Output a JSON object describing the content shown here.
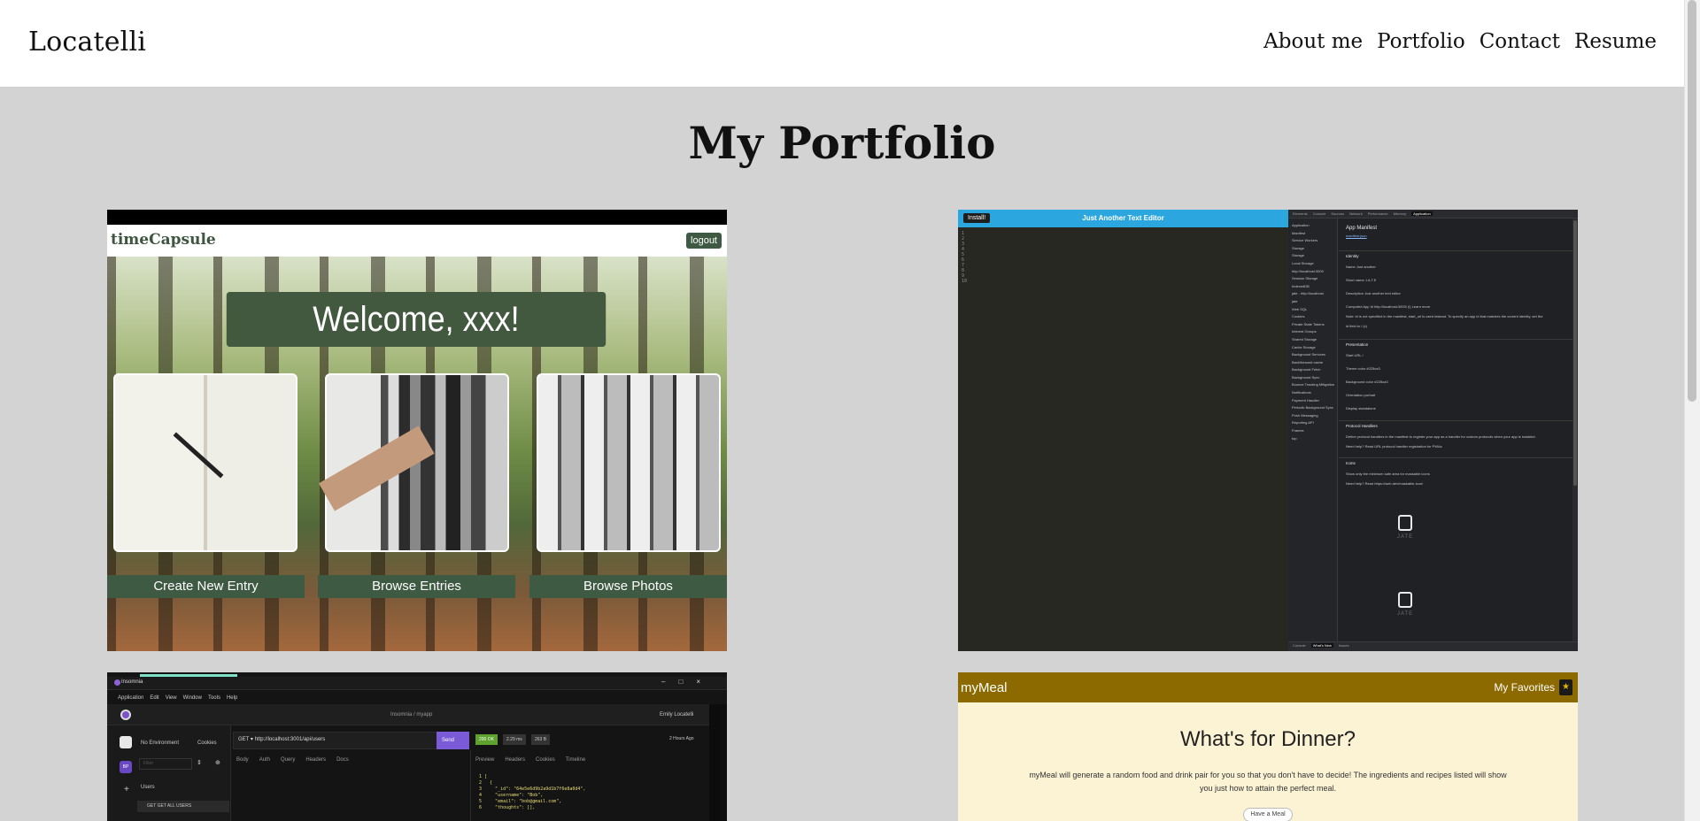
{
  "header": {
    "brand": "Locatelli",
    "nav": [
      "About me",
      "Portfolio",
      "Contact",
      "Resume"
    ]
  },
  "page_title": "My Portfolio",
  "projects": [
    {
      "app_name": "timeCapsule",
      "logout": "logout",
      "welcome": "Welcome, xxx!",
      "buttons": [
        "Create New Entry",
        "Browse Entries",
        "Browse Photos"
      ]
    },
    {
      "install": "Install!",
      "title": "Just Another Text Editor",
      "devtools_tabs": [
        "Elements",
        "Console",
        "Sources",
        "Network",
        "Performance",
        "Memory",
        "Application"
      ],
      "tree": [
        "Application",
        "Manifest",
        "Service Workers",
        "Storage",
        "",
        "Storage",
        "Local Storage",
        "http://localhost:3000",
        "Session Storage",
        "IndexedDB",
        "jate - http://localhost",
        "jate",
        "Web SQL",
        "Cookies",
        "Private State Tokens",
        "Interest Groups",
        "Shared Storage",
        "Cache Storage",
        "",
        "Background Services",
        "Back/forward cache",
        "Background Fetch",
        "Background Sync",
        "Bounce Tracking Mitigation",
        "Notifications",
        "Payment Handler",
        "Periodic Background Sync",
        "Push Messaging",
        "Reporting API",
        "",
        "Frames",
        "top"
      ],
      "manifest_title": "App Manifest",
      "manifest_link": "manifest.json",
      "sections": [
        "Identity",
        "Presentation",
        "Protocol Handlers",
        "Icons"
      ],
      "identity": [
        "Name  Just another",
        "Short name  J.A.T.E",
        "Description  Just another text editor",
        "Computed App Id  http://localhost:3000/ (i) Learn more",
        "Note: id is not specified in the manifest, start_url is used instead. To specify an app id that matches the current identity, set the",
        "id field to / (c)"
      ],
      "presentation": [
        "Start URL  /",
        "Theme color  #225ca3",
        "Background color  #225ca3",
        "Orientation  portrait",
        "Display  standalone"
      ],
      "protocol": [
        "Define protocol handlers in the manifest to register your app as a handler for custom protocols when your app is installed.",
        "Need help? Read URL protocol handler registration for PWAs"
      ],
      "icons_notes": [
        "Show only the minimum safe area for maskable icons",
        "Need help? Read https://web.dev/maskable-icon/"
      ],
      "logo_word": "JATE",
      "bottom_tabs": [
        "Console",
        "What's New",
        "Issues"
      ]
    },
    {
      "window_title": "Insomnia",
      "controls": [
        "–",
        "□",
        "×"
      ],
      "menu": [
        "Application",
        "Edit",
        "View",
        "Window",
        "Tools",
        "Help"
      ],
      "project": "Insomnia / myapp",
      "user": "Emily Locatelli",
      "environment": "No Environment",
      "cookies": "Cookies",
      "filter_placeholder": "Filter",
      "rail": "BP",
      "folder": "Users",
      "request": "GET   GET ALL USERS",
      "url": "GET ▾  http://localhost:3001/api/users",
      "send": "Send",
      "status": "200 OK",
      "time": "2.29 ms",
      "size": "263 B",
      "ago": "2 Hours Ago",
      "req_tabs": [
        "Body",
        "Auth",
        "Query",
        "Headers",
        "Docs"
      ],
      "res_tabs": [
        "Preview",
        "Headers",
        "Cookies",
        "Timeline"
      ],
      "json": "1 [\n2   {\n3     \"_id\": \"64e5e6d9b2a9d1b7f6e8a0d4\",\n4     \"username\": \"Bob\",\n5     \"email\": \"bob@gmail.com\",\n6     \"thoughts\": [],"
    },
    {
      "logo": "myMeal",
      "favorites": "My Favorites",
      "star": "★",
      "question": "What's for Dinner?",
      "description": "myMeal will generate a random food and drink pair for you so that you don't have to decide! The ingredients and recipes listed will show you just how to attain the perfect meal.",
      "button": "Have a Meal"
    }
  ]
}
